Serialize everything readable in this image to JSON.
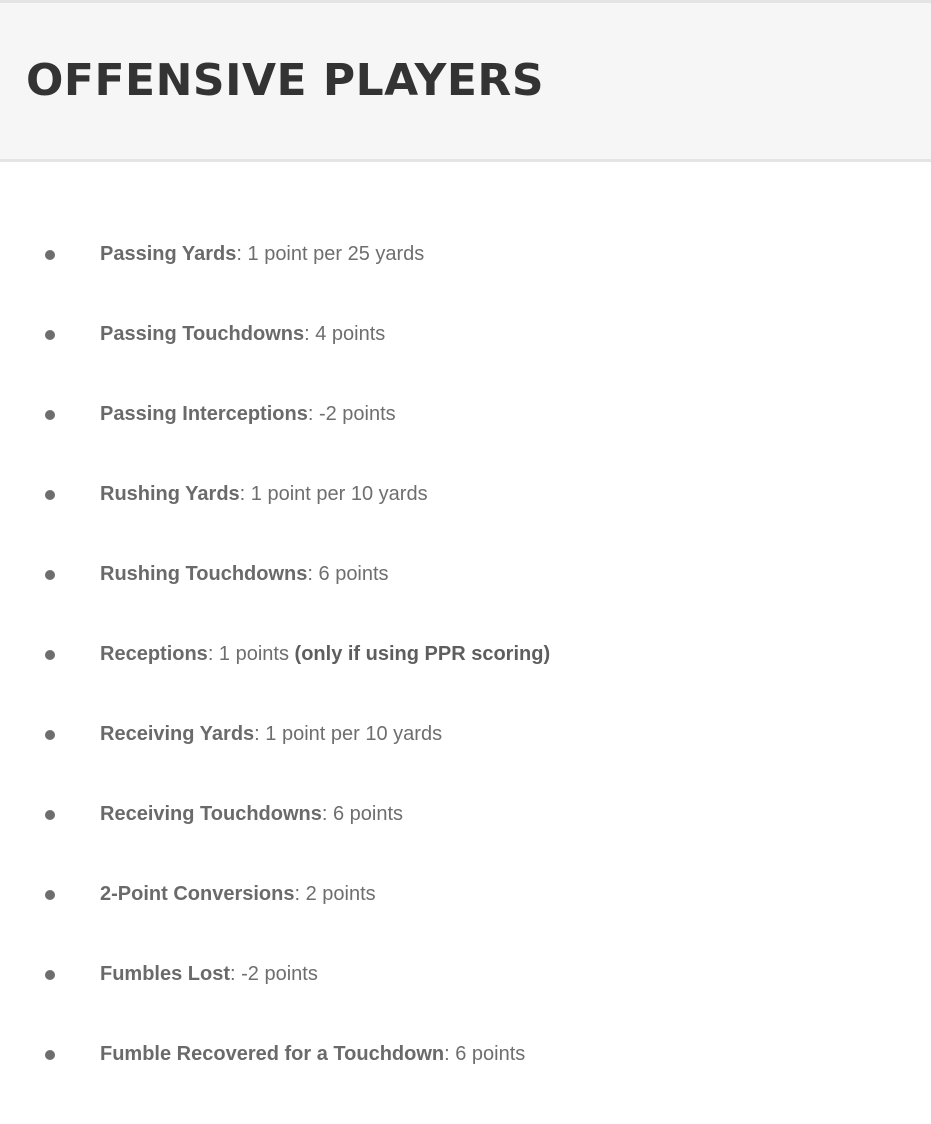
{
  "header": {
    "title": "OFFENSIVE PLAYERS"
  },
  "rules": [
    {
      "name": "Passing Yards",
      "separator": ":",
      "value": " 1 point per 25 yards",
      "note": ""
    },
    {
      "name": "Passing Touchdowns",
      "separator": ":",
      "value": " 4 points",
      "note": ""
    },
    {
      "name": "Passing Interceptions",
      "separator": ":",
      "value": " -2 points",
      "note": ""
    },
    {
      "name": "Rushing Yards",
      "separator": ":",
      "value": " 1 point per 10 yards",
      "note": ""
    },
    {
      "name": "Rushing Touchdowns",
      "separator": ":",
      "value": " 6 points",
      "note": ""
    },
    {
      "name": "Receptions",
      "separator": ":",
      "value": " 1 points ",
      "note": "(only if using PPR scoring)"
    },
    {
      "name": "Receiving Yards",
      "separator": ":",
      "value": " 1 point per 10 yards",
      "note": ""
    },
    {
      "name": "Receiving Touchdowns",
      "separator": ":",
      "value": " 6 points",
      "note": ""
    },
    {
      "name": "2-Point Conversions",
      "separator": ":",
      "value": " 2 points",
      "note": ""
    },
    {
      "name": "Fumbles Lost",
      "separator": ":",
      "value": " -2 points",
      "note": ""
    },
    {
      "name": "Fumble Recovered for a Touchdown",
      "separator": ":",
      "value": " 6 points",
      "note": ""
    }
  ]
}
